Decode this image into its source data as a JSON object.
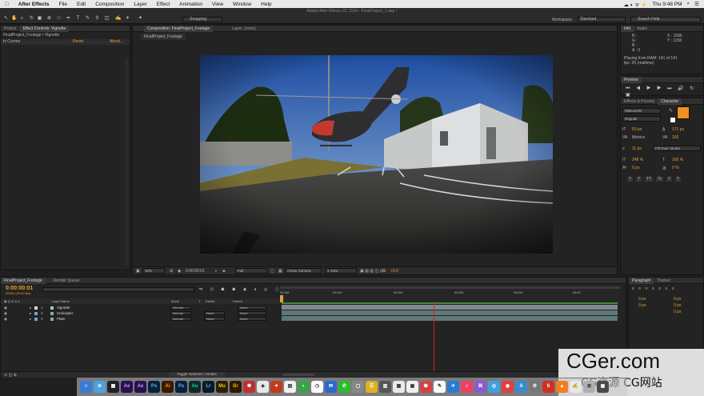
{
  "menubar": {
    "app": "After Effects",
    "items": [
      "File",
      "Edit",
      "Composition",
      "Layer",
      "Effect",
      "Animation",
      "View",
      "Window",
      "Help"
    ],
    "clock": "Thu 9:48 PM"
  },
  "toolbar": {
    "title": "Adobe After Effects CC 2014 - FinalProject_1.aep *",
    "snapping": "Snapping",
    "workspace_label": "Workspace:",
    "workspace_value": "Standard",
    "search_help": "Search Help"
  },
  "project_panel": {
    "tabs": [
      "Project",
      "Effect Controls: Vignette"
    ],
    "breadcrumb": "FinalProject_Footage • Vignette",
    "effect_name": "fx  Curves",
    "reset": "Reset",
    "about": "About..."
  },
  "comp_panel": {
    "tab": "Composition: FinalProject_Footage",
    "layer_tab": "Layer: (none)",
    "subtab": "FinalProject_Footage",
    "zoom": "10%",
    "time": "0:00:00:01",
    "resolution": "Full",
    "camera": "Active Camera",
    "views": "1 View",
    "exposure": "+0,0"
  },
  "info_panel": {
    "tabs": [
      "Info",
      "Audio"
    ],
    "channels": [
      "R :",
      "G :",
      "B :",
      "A : 0"
    ],
    "x": "X : 1586",
    "y": "Y : 1156",
    "playing": "Playing from RAM: 141 of 141",
    "fps": "fps: 25 (realtime)"
  },
  "preview_panel": {
    "tab": "Preview"
  },
  "character_panel": {
    "tabs": [
      "Effects & Presets",
      "Character"
    ],
    "font": "Mitsumishi",
    "style": "Regular",
    "size": "53 px",
    "leading": "171 px",
    "kerning": "Metrics",
    "tracking": "100",
    "stroke_width": "11 px",
    "stroke_type": "Fill Over Stroke",
    "vert_scale": "248 %",
    "horiz_scale": "165 %",
    "baseline": "0 px",
    "tsume": "0 %",
    "styles": [
      "T",
      "T",
      "TT",
      "Tt",
      "T",
      "T"
    ],
    "accent_color": "#f0901e"
  },
  "paragraph_panel": {
    "tabs": [
      "Paragraph",
      "Tracker"
    ],
    "fields": [
      "0 px",
      "0 px",
      "0 px",
      "0 px",
      "0 px"
    ]
  },
  "timeline": {
    "tabs": [
      "FinalProject_Footage",
      "Render Queue"
    ],
    "time": "0:00:00:01",
    "frame_info": "00001 (25.00 fps)",
    "columns": {
      "layer_name": "Layer Name",
      "mode": "Mode",
      "t": "T",
      "trkmat": "TrkMat",
      "parent": "Parent"
    },
    "ruler": [
      "01:00f",
      "01:01f",
      "02:01f",
      "03:01f",
      "04:01f",
      "05:01"
    ],
    "layers": [
      {
        "num": "1",
        "name": "Vignette",
        "mode": "Normal",
        "trkmat": "",
        "parent": "None",
        "color": "#d8d8d8"
      },
      {
        "num": "2",
        "name": "Helicopter",
        "mode": "Normal",
        "trkmat": "None",
        "parent": "None",
        "color": "#6fa8c9"
      },
      {
        "num": "3",
        "name": "Plate",
        "mode": "Normal",
        "trkmat": "None",
        "parent": "None",
        "color": "#6fa8c9"
      }
    ],
    "toggle": "Toggle Switches / Modes"
  },
  "watermark": {
    "title": "CGer.com",
    "subtitle": "CG资源 CG网站"
  },
  "dock": {
    "icons": [
      "finder-icon",
      "safari-icon",
      "clapper-icon",
      "ae-icon",
      "ae-icon",
      "ps-icon",
      "ai-icon",
      "ps-icon",
      "au-icon",
      "lr-icon",
      "mu-icon",
      "br-icon",
      "bug-icon",
      "app-icon",
      "app-icon",
      "app-icon",
      "app-icon",
      "app-icon",
      "app-icon",
      "app-icon",
      "app-icon",
      "app-icon",
      "app-icon",
      "app-icon",
      "app-icon",
      "app-icon",
      "app-icon",
      "app-icon",
      "app-icon",
      "app-icon",
      "app-icon",
      "app-icon",
      "app-icon",
      "app-icon",
      "app-icon",
      "app-icon",
      "app-icon",
      "app-icon"
    ],
    "labels": [
      "",
      "",
      "",
      "Ae",
      "Ae",
      "Ps",
      "Ai",
      "Ps",
      "Au",
      "Lr",
      "Mu",
      "Br"
    ]
  }
}
